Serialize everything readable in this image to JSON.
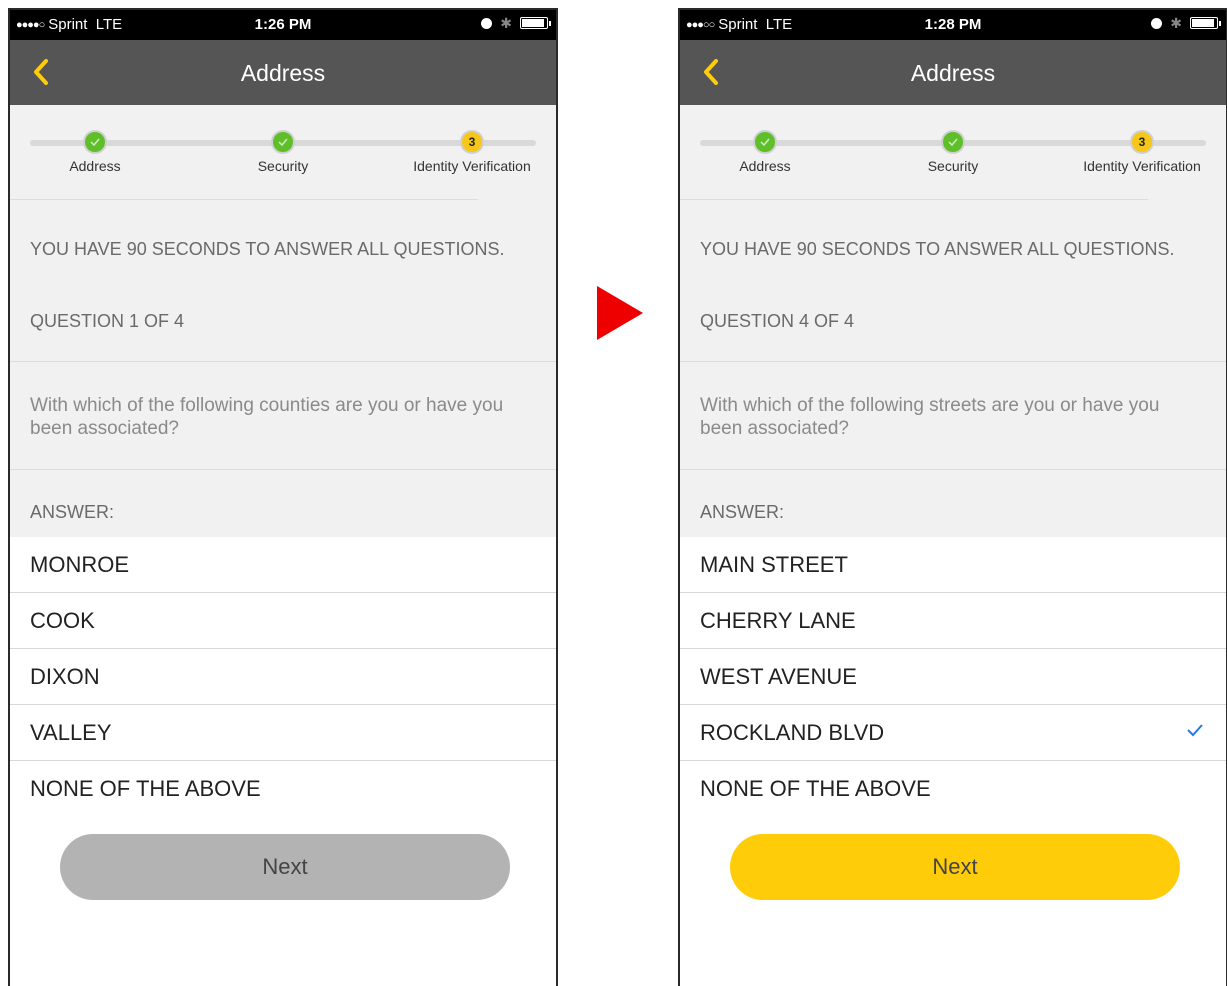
{
  "screens": [
    {
      "status": {
        "carrier": "Sprint",
        "network": "LTE",
        "time": "1:26 PM",
        "signal": "●●●●○"
      },
      "nav": {
        "title": "Address",
        "back_icon": "chevron-left-icon"
      },
      "stepper": [
        {
          "label": "Address",
          "state": "done"
        },
        {
          "label": "Security",
          "state": "done"
        },
        {
          "label": "Identity Verification",
          "state": "current",
          "number": "3"
        }
      ],
      "instructions": "YOU HAVE 90 SECONDS TO ANSWER ALL QUESTIONS.",
      "question_count": "QUESTION 1 OF 4",
      "question": "With which of the following counties are you or have you been associated?",
      "answer_label": "ANSWER:",
      "answers": [
        "MONROE",
        "COOK",
        "DIXON",
        "VALLEY",
        "NONE OF THE ABOVE"
      ],
      "selected": null,
      "next_label": "Next",
      "next_state": "disabled"
    },
    {
      "status": {
        "carrier": "Sprint",
        "network": "LTE",
        "time": "1:28 PM",
        "signal": "●●●○○"
      },
      "nav": {
        "title": "Address",
        "back_icon": "chevron-left-icon"
      },
      "stepper": [
        {
          "label": "Address",
          "state": "done"
        },
        {
          "label": "Security",
          "state": "done"
        },
        {
          "label": "Identity Verification",
          "state": "current",
          "number": "3"
        }
      ],
      "instructions": "YOU HAVE 90 SECONDS TO ANSWER ALL QUESTIONS.",
      "question_count": "QUESTION 4 OF 4",
      "question": "With which of the following streets are you or have you been associated?",
      "answer_label": "ANSWER:",
      "answers": [
        "MAIN STREET",
        "CHERRY LANE",
        "WEST AVENUE",
        "ROCKLAND BLVD",
        "NONE OF THE ABOVE"
      ],
      "selected": "ROCKLAND BLVD",
      "next_label": "Next",
      "next_state": "enabled"
    }
  ],
  "colors": {
    "accent": "#ffcc0a",
    "nav_bg": "#555555",
    "step_done": "#5fbf2a",
    "step_current": "#f6c718",
    "check": "#1e7ce8",
    "transition_arrow": "#ee0000"
  }
}
